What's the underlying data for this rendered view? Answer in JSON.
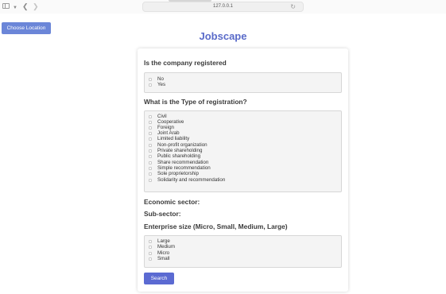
{
  "browser": {
    "url": "127.0.0.1"
  },
  "choose_location_label": "Choose Location",
  "title": "Jobscape",
  "form": {
    "q_registered": "Is the company registered",
    "registered_options": [
      "No",
      "Yes"
    ],
    "q_type": "What is the Type of registration?",
    "type_options": [
      "Civil",
      "Cooperative",
      "Foreign",
      "Joint Arab",
      "Limited liability",
      "Non-profit organization",
      "Private shareholding",
      "Public shareholding",
      "Share recommendation",
      "Simple recommendation",
      "Sole proprietorship",
      "Solidarity and recommendation"
    ],
    "economic_sector": "Economic sector:",
    "sub_sector": "Sub-sector:",
    "q_size": "Enterprise size (Micro, Small, Medium, Large)",
    "size_options": [
      "Large",
      "Medium",
      "Micro",
      "Small"
    ],
    "search_label": "Search"
  }
}
